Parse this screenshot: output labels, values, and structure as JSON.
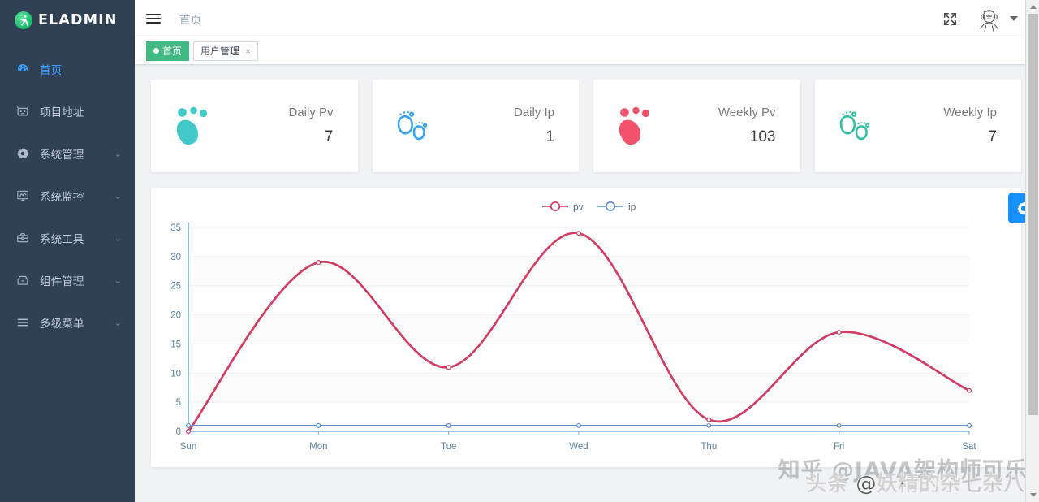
{
  "sidebar": {
    "logo_text": "ELADMIN",
    "items": [
      {
        "label": "首页",
        "icon": "dashboard-icon",
        "active": true,
        "chevron": false
      },
      {
        "label": "项目地址",
        "icon": "github-cat-icon",
        "active": false,
        "chevron": false
      },
      {
        "label": "系统管理",
        "icon": "gear-icon",
        "active": false,
        "chevron": true
      },
      {
        "label": "系统监控",
        "icon": "monitor-icon",
        "active": false,
        "chevron": true
      },
      {
        "label": "系统工具",
        "icon": "toolbox-icon",
        "active": false,
        "chevron": true
      },
      {
        "label": "组件管理",
        "icon": "component-icon",
        "active": false,
        "chevron": true
      },
      {
        "label": "多级菜单",
        "icon": "menu-lines-icon",
        "active": false,
        "chevron": true
      }
    ]
  },
  "navbar": {
    "hamburger": "hamburger-icon",
    "breadcrumb": "首页",
    "fullscreen_icon": "fullscreen-icon",
    "avatar_icon": "avatar",
    "caret_icon": "chevron-down-icon"
  },
  "tags": [
    {
      "label": "首页",
      "active": true,
      "closable": false
    },
    {
      "label": "用户管理",
      "active": false,
      "closable": true,
      "close_label": "×"
    }
  ],
  "cards": [
    {
      "title": "Daily Pv",
      "value": "7",
      "icon": "footprint-solid-icon",
      "color": "#40C9C6"
    },
    {
      "title": "Daily Ip",
      "value": "1",
      "icon": "footprint-outline-icon",
      "color": "#36A3F7"
    },
    {
      "title": "Weekly Pv",
      "value": "103",
      "icon": "footprint-solid-icon",
      "color": "#F4516C"
    },
    {
      "title": "Weekly Ip",
      "value": "7",
      "icon": "footprint-outline-icon",
      "color": "#34BFA3"
    }
  ],
  "settings_button": {
    "icon": "gear-icon",
    "color": "#1890ff"
  },
  "watermarks": {
    "zhihu": "知乎 @JAVA架构师可乐",
    "toutiao": "头条 @妖精的杂七杂八"
  },
  "chart_data": {
    "type": "line",
    "title": "",
    "categories": [
      "Sun",
      "Mon",
      "Tue",
      "Wed",
      "Thu",
      "Fri",
      "Sat"
    ],
    "series": [
      {
        "name": "pv",
        "color": "#d13c63",
        "values": [
          0,
          29,
          11,
          34,
          2,
          17,
          7
        ]
      },
      {
        "name": "ip",
        "color": "#5a8bd6",
        "values": [
          1,
          1,
          1,
          1,
          1,
          1,
          1
        ]
      }
    ],
    "ylim": [
      0,
      35
    ],
    "yticks": [
      0,
      5,
      10,
      15,
      20,
      25,
      30,
      35
    ],
    "xlabel": "",
    "ylabel": "",
    "grid": true,
    "smooth": true,
    "legend_position": "top-center",
    "axis_label_color": "#5b7f9e"
  }
}
